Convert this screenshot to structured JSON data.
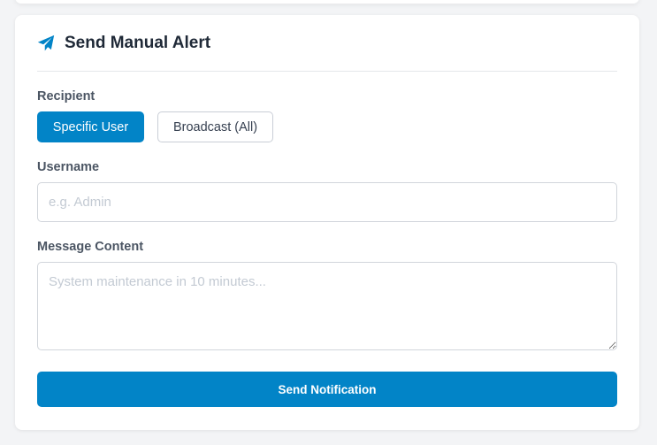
{
  "card": {
    "title": "Send Manual Alert",
    "icon": "paper-plane-icon",
    "accent_color": "#0284c7"
  },
  "recipient": {
    "label": "Recipient",
    "options": [
      "Specific User",
      "Broadcast (All)"
    ],
    "selected": "Specific User"
  },
  "username": {
    "label": "Username",
    "value": "",
    "placeholder": "e.g. Admin"
  },
  "message": {
    "label": "Message Content",
    "value": "",
    "placeholder": "System maintenance in 10 minutes..."
  },
  "submit": {
    "label": "Send Notification"
  }
}
